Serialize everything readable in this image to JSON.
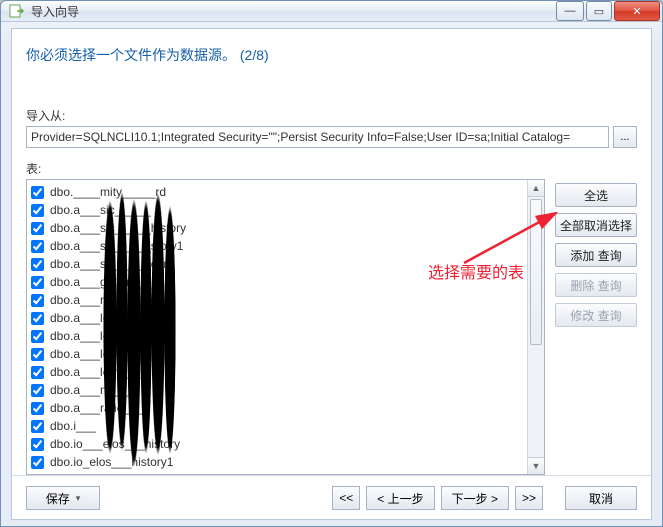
{
  "window": {
    "title": "导入向导",
    "min_glyph": "—",
    "max_glyph": "▭",
    "close_glyph": "✕"
  },
  "main": {
    "heading": "你必须选择一个文件作为数据源。 (2/8)"
  },
  "import": {
    "label": "导入从:",
    "value": "Provider=SQLNCLI10.1;Integrated Security=\"\";Persist Security Info=False;User ID=sa;Initial Catalog=",
    "browse_label": "..."
  },
  "tables": {
    "label": "表:",
    "items": [
      "dbo.____mity_____rd",
      "dbo.a___sic_i____",
      "dbo.a___sic_i____history",
      "dbo.a___sic_i____story1",
      "dbo.a___sic_i____cent",
      "dbo.a___ght_inf____",
      "dbo.a___nove___e__",
      "dbo.a___le_c____",
      "dbo.a___le_i___ll",
      "dbo.a___le_s___i__",
      "dbo.a___le_v___",
      "dbo.a___na___",
      "dbo.a___ratio___o",
      "dbo.i___",
      "dbo.io___elos___history",
      "dbo.io_elos___history1"
    ]
  },
  "side_buttons": {
    "select_all": "全选",
    "deselect_all": "全部取消选择",
    "add_query": "添加 查询",
    "delete_query": "删除 查询",
    "modify_query": "修改 查询"
  },
  "annotation": {
    "select_tables_text": "选择需要的表"
  },
  "bottom": {
    "save": "保存",
    "first": "<<",
    "prev": "< 上一步",
    "next": "下一步 >",
    "last": ">>",
    "cancel": "取消"
  },
  "scroll": {
    "up_glyph": "▲",
    "down_glyph": "▼"
  }
}
